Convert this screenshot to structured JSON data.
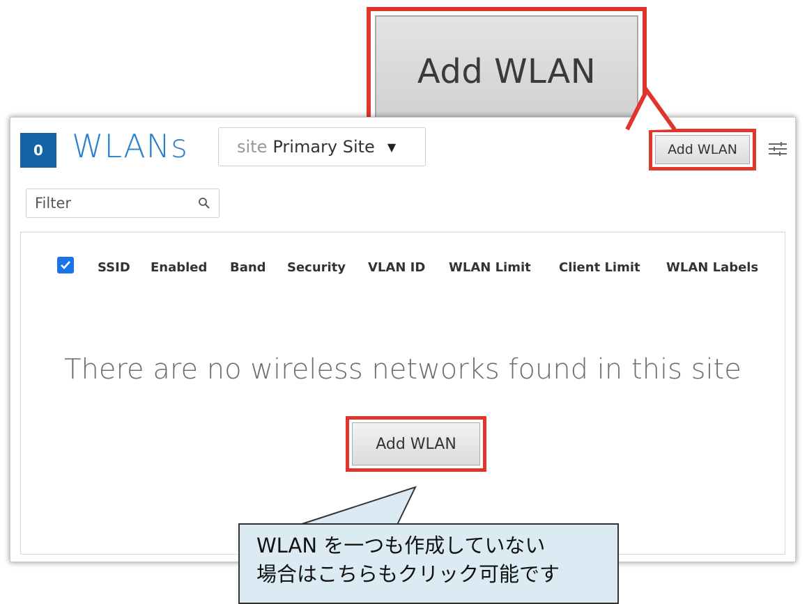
{
  "zoom_callout": {
    "label": "Add WLAN"
  },
  "header": {
    "count": "0",
    "title": "WLANs",
    "site_label": "site",
    "site_value": "Primary Site",
    "add_button": "Add WLAN"
  },
  "filter": {
    "placeholder": "Filter"
  },
  "table": {
    "columns": [
      "SSID",
      "Enabled",
      "Band",
      "Security",
      "VLAN ID",
      "WLAN Limit",
      "Client Limit",
      "WLAN Labels"
    ]
  },
  "empty_state": {
    "message": "There are no wireless networks found in this site",
    "add_button": "Add WLAN"
  },
  "note": {
    "line1": "WLAN を一つも作成していない",
    "line2": "場合はこちらもクリック可能です"
  },
  "colors": {
    "highlight": "#e0352b",
    "accent": "#1563a7",
    "title": "#2a7fcf",
    "note_bg": "#dcebf3"
  }
}
